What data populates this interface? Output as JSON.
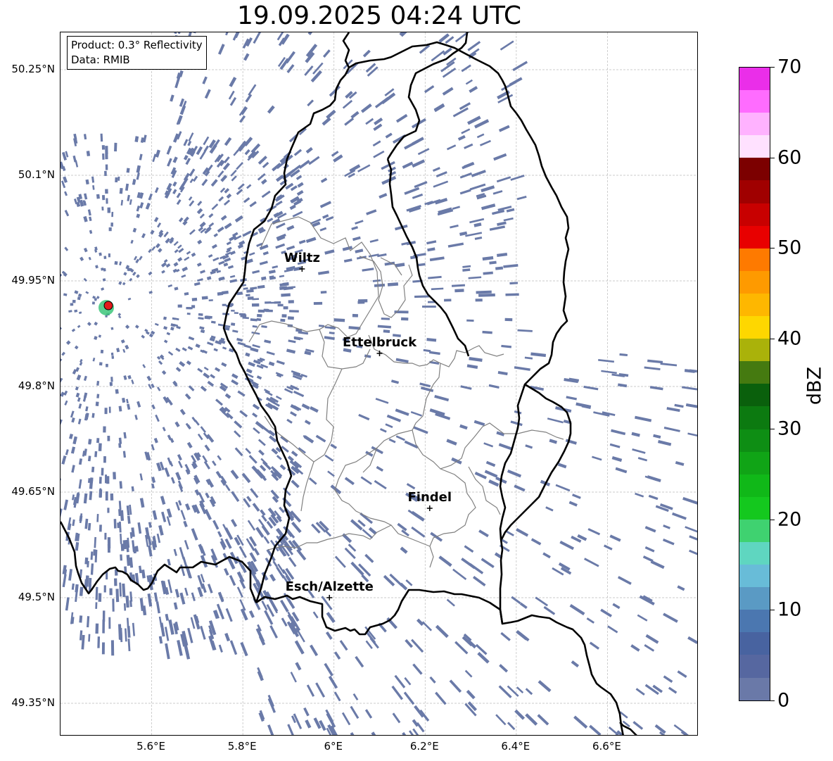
{
  "title": "19.09.2025 04:24 UTC",
  "info_box": {
    "product": "Product: 0.3° Reflectivity",
    "source": "Data: RMIB"
  },
  "map": {
    "lon_range": [
      5.4,
      6.8
    ],
    "lat_range": [
      49.3,
      50.3
    ],
    "lat_ticks": [
      "50.25°N",
      "50.1°N",
      "49.95°N",
      "49.8°N",
      "49.65°N",
      "49.5°N",
      "49.35°N"
    ],
    "lon_ticks": [
      "5.6°E",
      "5.8°E",
      "6°E",
      "6.2°E",
      "6.4°E",
      "6.6°E"
    ],
    "grid": true,
    "cities": [
      {
        "name": "Wiltz",
        "lon": 5.93,
        "lat": 49.967
      },
      {
        "name": "Ettelbruck",
        "lon": 6.1,
        "lat": 49.847
      },
      {
        "name": "Findel",
        "lon": 6.21,
        "lat": 49.627
      },
      {
        "name": "Esch/Alzette",
        "lon": 5.99,
        "lat": 49.5
      }
    ],
    "radar_site": {
      "lon": 5.505,
      "lat": 49.915
    },
    "colors": {
      "border": "#000000",
      "cantons": "#808080",
      "echo": "#6a7aa8",
      "radar_marker": "#e31a1c",
      "radar_ring": "#3cc57a"
    }
  },
  "colorbar": {
    "label": "dBZ",
    "min": 0,
    "max": 70,
    "tick_labels": [
      "0",
      "10",
      "20",
      "30",
      "40",
      "50",
      "60",
      "70"
    ],
    "bins": [
      "#6a79a8",
      "#5667a0",
      "#4863a0",
      "#4b77b0",
      "#5a9ac4",
      "#68bcd8",
      "#5fd6c0",
      "#3fd270",
      "#14c81e",
      "#10b818",
      "#10a416",
      "#0e8e14",
      "#0c7a10",
      "#0a600c",
      "#457a10",
      "#aab20a",
      "#fed700",
      "#feb700",
      "#fe9a00",
      "#fe7a00",
      "#e80000",
      "#c80000",
      "#a00000",
      "#7c0000",
      "#ffe1ff",
      "#ffb2ff",
      "#ff6cff",
      "#ea2ee9"
    ]
  }
}
